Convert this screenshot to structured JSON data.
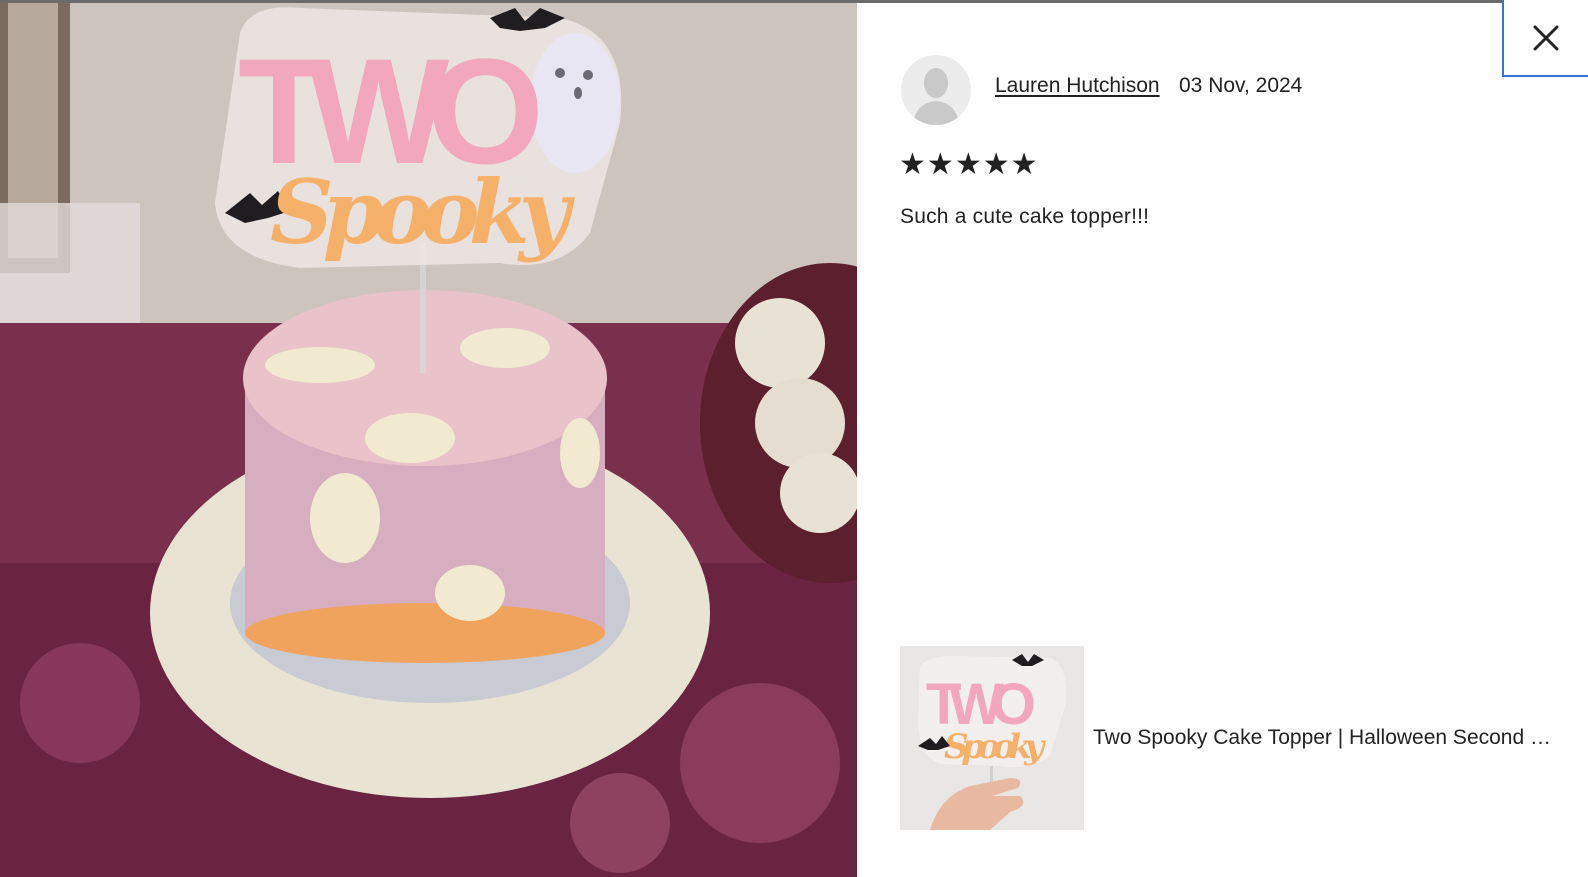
{
  "photo": {
    "topper_line1": "TWO",
    "topper_line2": "Spooky"
  },
  "review": {
    "reviewer_name": "Lauren Hutchison",
    "date": "03 Nov, 2024",
    "rating": 5,
    "rating_max": 5,
    "text": "Such a cute cake topper!!!"
  },
  "product": {
    "title": "Two Spooky Cake Topper | Halloween Second Birthday Cake Topper"
  },
  "icons": {
    "close": "close-icon",
    "star": "star-icon",
    "avatar": "avatar-placeholder-icon"
  },
  "colors": {
    "topper_pink": "#f2a7bf",
    "topper_orange": "#f5b06a",
    "close_focus_border": "#3b6fd8",
    "text": "#222222"
  }
}
